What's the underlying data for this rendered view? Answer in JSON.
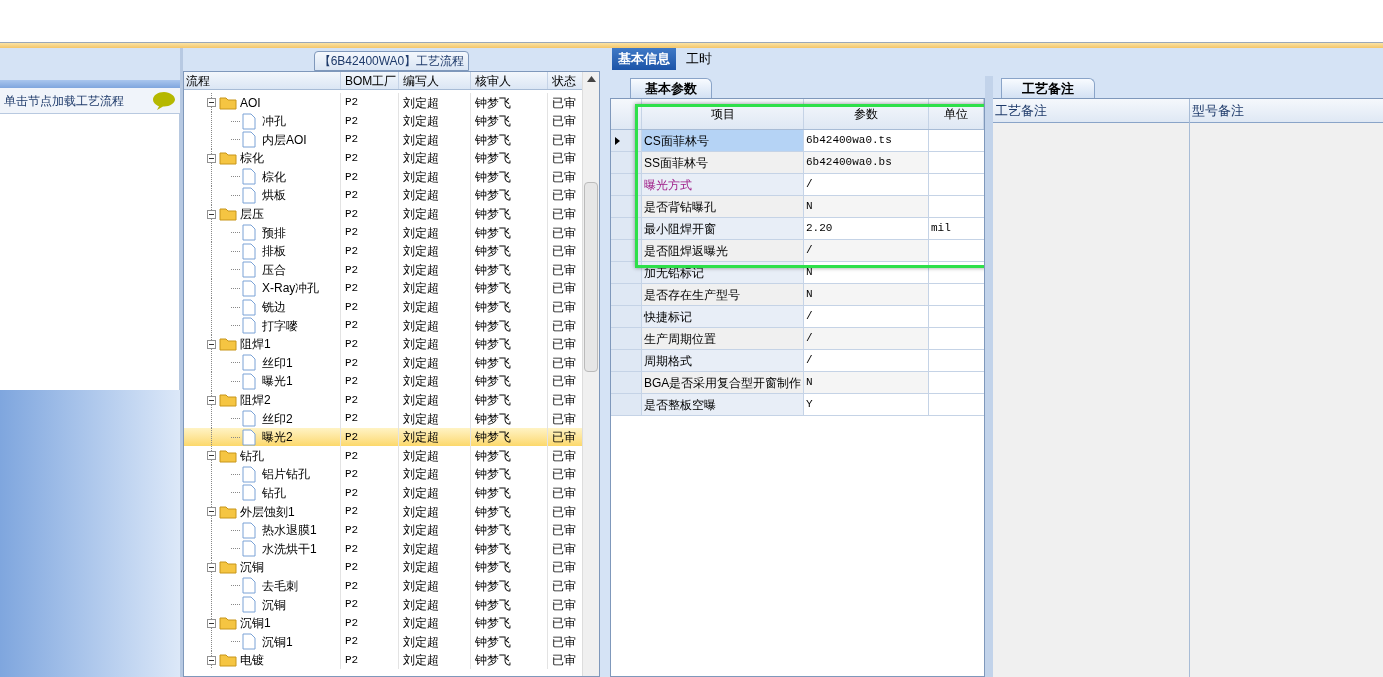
{
  "left_panel": {
    "message": "单击节点加载工艺流程"
  },
  "tree": {
    "title": "【6B42400WA0】工艺流程",
    "columns": [
      "流程",
      "BOM工厂",
      "编写人",
      "核审人",
      "状态"
    ],
    "rows": [
      {
        "name": "AOI",
        "bom": "P2",
        "author": "刘定超",
        "reviewer": "钟梦飞",
        "status": "已审",
        "expanded": true,
        "selected": false,
        "children": [
          {
            "name": "冲孔",
            "bom": "P2",
            "author": "刘定超",
            "reviewer": "钟梦飞",
            "status": "已审",
            "selected": false
          },
          {
            "name": "内层AOI",
            "bom": "P2",
            "author": "刘定超",
            "reviewer": "钟梦飞",
            "status": "已审",
            "selected": false
          }
        ]
      },
      {
        "name": "棕化",
        "bom": "P2",
        "author": "刘定超",
        "reviewer": "钟梦飞",
        "status": "已审",
        "expanded": true,
        "selected": false,
        "children": [
          {
            "name": "棕化",
            "bom": "P2",
            "author": "刘定超",
            "reviewer": "钟梦飞",
            "status": "已审",
            "selected": false
          },
          {
            "name": "烘板",
            "bom": "P2",
            "author": "刘定超",
            "reviewer": "钟梦飞",
            "status": "已审",
            "selected": false
          }
        ]
      },
      {
        "name": "层压",
        "bom": "P2",
        "author": "刘定超",
        "reviewer": "钟梦飞",
        "status": "已审",
        "expanded": true,
        "selected": false,
        "children": [
          {
            "name": "预排",
            "bom": "P2",
            "author": "刘定超",
            "reviewer": "钟梦飞",
            "status": "已审",
            "selected": false
          },
          {
            "name": "排板",
            "bom": "P2",
            "author": "刘定超",
            "reviewer": "钟梦飞",
            "status": "已审",
            "selected": false
          },
          {
            "name": "压合",
            "bom": "P2",
            "author": "刘定超",
            "reviewer": "钟梦飞",
            "status": "已审",
            "selected": false
          },
          {
            "name": "X-Ray冲孔",
            "bom": "P2",
            "author": "刘定超",
            "reviewer": "钟梦飞",
            "status": "已审",
            "selected": false
          },
          {
            "name": "铣边",
            "bom": "P2",
            "author": "刘定超",
            "reviewer": "钟梦飞",
            "status": "已审",
            "selected": false
          },
          {
            "name": "打字嘜",
            "bom": "P2",
            "author": "刘定超",
            "reviewer": "钟梦飞",
            "status": "已审",
            "selected": false
          }
        ]
      },
      {
        "name": "阻焊1",
        "bom": "P2",
        "author": "刘定超",
        "reviewer": "钟梦飞",
        "status": "已审",
        "expanded": true,
        "selected": false,
        "children": [
          {
            "name": "丝印1",
            "bom": "P2",
            "author": "刘定超",
            "reviewer": "钟梦飞",
            "status": "已审",
            "selected": false
          },
          {
            "name": "曝光1",
            "bom": "P2",
            "author": "刘定超",
            "reviewer": "钟梦飞",
            "status": "已审",
            "selected": false
          }
        ]
      },
      {
        "name": "阻焊2",
        "bom": "P2",
        "author": "刘定超",
        "reviewer": "钟梦飞",
        "status": "已审",
        "expanded": true,
        "selected": false,
        "children": [
          {
            "name": "丝印2",
            "bom": "P2",
            "author": "刘定超",
            "reviewer": "钟梦飞",
            "status": "已审",
            "selected": false
          },
          {
            "name": "曝光2",
            "bom": "P2",
            "author": "刘定超",
            "reviewer": "钟梦飞",
            "status": "已审",
            "selected": true
          }
        ]
      },
      {
        "name": "钻孔",
        "bom": "P2",
        "author": "刘定超",
        "reviewer": "钟梦飞",
        "status": "已审",
        "expanded": true,
        "selected": false,
        "children": [
          {
            "name": "铝片钻孔",
            "bom": "P2",
            "author": "刘定超",
            "reviewer": "钟梦飞",
            "status": "已审",
            "selected": false
          },
          {
            "name": "钻孔",
            "bom": "P2",
            "author": "刘定超",
            "reviewer": "钟梦飞",
            "status": "已审",
            "selected": false
          }
        ]
      },
      {
        "name": "外层蚀刻1",
        "bom": "P2",
        "author": "刘定超",
        "reviewer": "钟梦飞",
        "status": "已审",
        "expanded": true,
        "selected": false,
        "children": [
          {
            "name": "热水退膜1",
            "bom": "P2",
            "author": "刘定超",
            "reviewer": "钟梦飞",
            "status": "已审",
            "selected": false
          },
          {
            "name": "水洗烘干1",
            "bom": "P2",
            "author": "刘定超",
            "reviewer": "钟梦飞",
            "status": "已审",
            "selected": false
          }
        ]
      },
      {
        "name": "沉铜",
        "bom": "P2",
        "author": "刘定超",
        "reviewer": "钟梦飞",
        "status": "已审",
        "expanded": true,
        "selected": false,
        "children": [
          {
            "name": "去毛刺",
            "bom": "P2",
            "author": "刘定超",
            "reviewer": "钟梦飞",
            "status": "已审",
            "selected": false
          },
          {
            "name": "沉铜",
            "bom": "P2",
            "author": "刘定超",
            "reviewer": "钟梦飞",
            "status": "已审",
            "selected": false
          }
        ]
      },
      {
        "name": "沉铜1",
        "bom": "P2",
        "author": "刘定超",
        "reviewer": "钟梦飞",
        "status": "已审",
        "expanded": true,
        "selected": false,
        "children": [
          {
            "name": "沉铜1",
            "bom": "P2",
            "author": "刘定超",
            "reviewer": "钟梦飞",
            "status": "已审",
            "selected": false
          }
        ]
      },
      {
        "name": "电镀",
        "bom": "P2",
        "author": "刘定超",
        "reviewer": "钟梦飞",
        "status": "已审",
        "expanded": true,
        "selected": false
      }
    ]
  },
  "main_tabs": [
    {
      "label": "基本信息",
      "selected": true
    },
    {
      "label": "工时",
      "selected": false
    }
  ],
  "params": {
    "tab": "基本参数",
    "columns": [
      "项目",
      "参数",
      "单位"
    ],
    "rows": [
      {
        "item": "CS面菲林号",
        "value": "6b42400wa0.ts",
        "selected": true,
        "emphasized": false
      },
      {
        "item": "SS面菲林号",
        "value": "6b42400wa0.bs",
        "selected": false,
        "emphasized": false
      },
      {
        "item": "曝光方式",
        "value": "/",
        "selected": false,
        "emphasized": true
      },
      {
        "item": "是否背钻曝孔",
        "value": "N",
        "selected": false,
        "emphasized": false
      },
      {
        "item": "最小阻焊开窗",
        "value": "2.20",
        "unit": "mil",
        "selected": false,
        "emphasized": false
      },
      {
        "item": "是否阻焊返曝光",
        "value": "/",
        "selected": false,
        "emphasized": false
      },
      {
        "item": "加无铅标记",
        "value": "N",
        "selected": false,
        "emphasized": false
      },
      {
        "item": "是否存在生产型号",
        "value": "N",
        "selected": false,
        "emphasized": false
      },
      {
        "item": "快捷标记",
        "value": "/",
        "selected": false,
        "emphasized": false
      },
      {
        "item": "生产周期位置",
        "value": "/",
        "selected": false,
        "emphasized": false
      },
      {
        "item": "周期格式",
        "value": "/",
        "selected": false,
        "emphasized": false
      },
      {
        "item": "BGA是否采用复合型开窗制作",
        "value": "N",
        "selected": false,
        "emphasized": false
      },
      {
        "item": "是否整板空曝",
        "value": "Y",
        "selected": false,
        "emphasized": false
      }
    ]
  },
  "notes": {
    "tab": "工艺备注",
    "columns": [
      "工艺备注",
      "型号备注"
    ]
  }
}
